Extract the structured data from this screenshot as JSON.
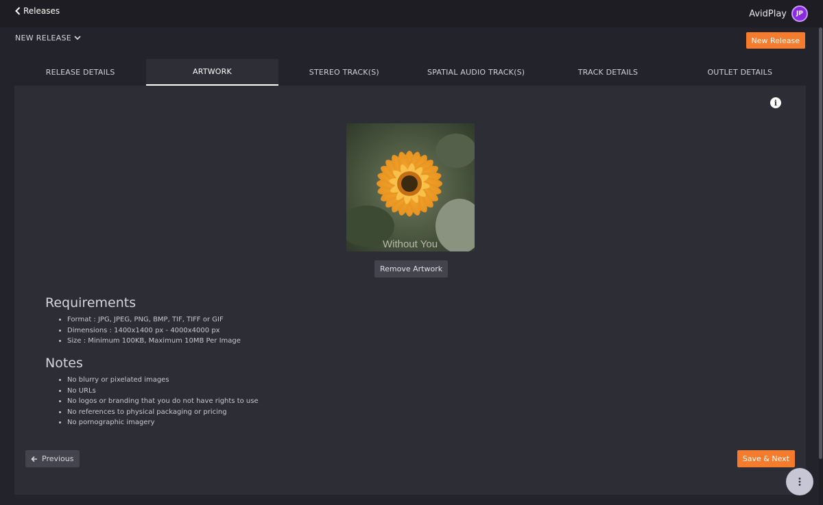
{
  "topbar": {
    "back_label": "Releases",
    "brand_name": "AvidPlay",
    "brand_logo_text": "JP"
  },
  "header": {
    "release_dropdown_label": "NEW RELEASE",
    "new_release_button": "New Release"
  },
  "tabs": [
    {
      "label": "RELEASE DETAILS",
      "active": false
    },
    {
      "label": "ARTWORK",
      "active": true
    },
    {
      "label": "STEREO TRACK(S)",
      "active": false
    },
    {
      "label": "SPATIAL AUDIO TRACK(S)",
      "active": false
    },
    {
      "label": "TRACK DETAILS",
      "active": false
    },
    {
      "label": "OUTLET DETAILS",
      "active": false
    }
  ],
  "artwork": {
    "overlay_text": "Without You",
    "remove_button": "Remove Artwork"
  },
  "requirements": {
    "title": "Requirements",
    "items": [
      "Format : JPG, JPEG, PNG, BMP, TIF, TIFF or GIF",
      "Dimensions : 1400x1400 px - 4000x4000 px",
      "Size : Minimum 100KB, Maximum 10MB Per Image"
    ]
  },
  "notes": {
    "title": "Notes",
    "items": [
      "No blurry or pixelated images",
      "No URLs",
      "No logos or branding that you do not have rights to use",
      "No references to physical packaging or pricing",
      "No pornographic imagery"
    ]
  },
  "footer": {
    "previous_button": "Previous",
    "save_next_button": "Save & Next"
  },
  "colors": {
    "accent": "#f57c2c",
    "background": "#23232b",
    "panel": "#2d2d36"
  }
}
